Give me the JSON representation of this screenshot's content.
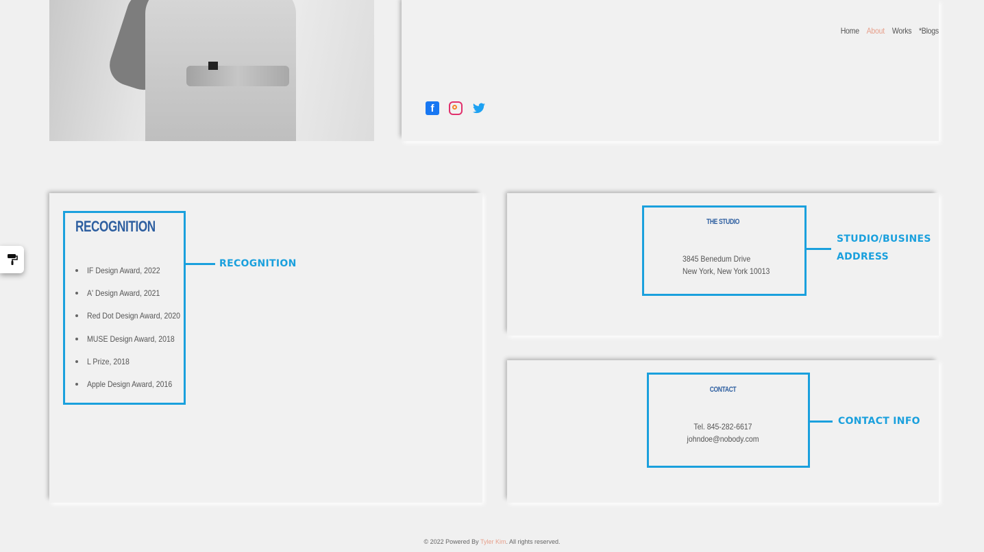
{
  "nav": {
    "items": [
      {
        "label": "Home",
        "active": false
      },
      {
        "label": "About",
        "active": true
      },
      {
        "label": "Works",
        "active": false
      },
      {
        "label": "*Blogs",
        "active": false
      }
    ],
    "accent_color": "#e7a08c"
  },
  "social": {
    "icons": [
      "facebook-icon",
      "instagram-icon",
      "twitter-icon"
    ]
  },
  "recognition": {
    "title": "RECOGNITION",
    "items": [
      "IF Design Award, 2022",
      "A' Design Award, 2021",
      "Red Dot Design Award, 2020",
      "MUSE Design Award, 2018",
      "L Prize, 2018",
      "Apple Design Award, 2016"
    ]
  },
  "studio": {
    "title": "THE STUDIO",
    "address_line1": "3845 Benedum Drive",
    "address_line2": "New York, New York 10013"
  },
  "contact": {
    "title": "CONTACT",
    "phone": "Tel. 845-282-6617",
    "email": "johndoe@nobody.com"
  },
  "annotations": {
    "recognition_label": "RECOGNITION",
    "studio_label_line1": "STUDIO/BUSINES",
    "studio_label_line2": "ADDRESS",
    "contact_label": "CONTACT INFO",
    "color": "#1aa0dd"
  },
  "footer": {
    "prefix": "© 2022 Powered By ",
    "name": "Tyler Kim",
    "suffix": ". All rights reserved."
  },
  "tool_button": {
    "icon": "paint-roller-icon"
  }
}
